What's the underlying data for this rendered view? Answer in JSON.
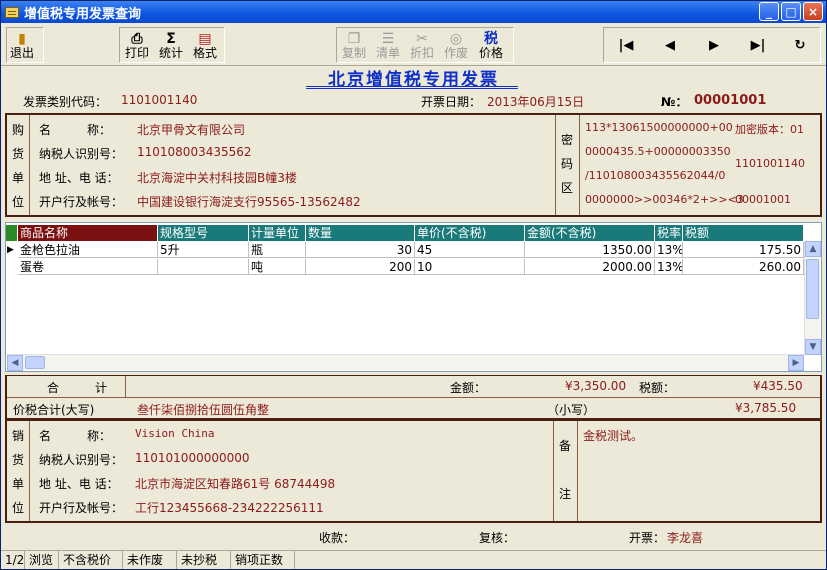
{
  "window": {
    "title": "增值税专用发票查询",
    "min": "_",
    "max": "□",
    "close": "×"
  },
  "toolbar": {
    "exit": "退出",
    "print": "打印",
    "stats": "统计",
    "format": "格式",
    "copy": "复制",
    "list": "清单",
    "discount": "折扣",
    "void": "作废",
    "tax_price_top": "税",
    "tax_price": "价格",
    "nav_first": "|◀",
    "nav_prev": "◀",
    "nav_next": "▶",
    "nav_last": "▶|",
    "nav_refresh": "↻"
  },
  "form": {
    "title": "北京增值税专用发票",
    "code_label": "发票类别代码：",
    "code": "1101001140",
    "date_label": "开票日期：",
    "date": "2013年06月15日",
    "no_label": "№：",
    "no": "00001001"
  },
  "buyer": {
    "side": [
      "购",
      "货",
      "单",
      "位"
    ],
    "name_label": "名　　　称：",
    "name": "北京甲骨文有限公司",
    "taxid_label": "纳税人识别号：",
    "taxid": "110108003435562",
    "addr_label": "地 址、电 话：",
    "addr": "北京海淀中关村科技园B幢3楼",
    "bank_label": "开户行及帐号：",
    "bank": "中国建设银行海淀支行95565-13562482"
  },
  "cipher": {
    "side": [
      "密",
      "码",
      "区"
    ],
    "lines": [
      "113*13061500000000+00",
      "0000435.5+00000003350",
      "/11010800343556204​4/0",
      "0000000>>00346*2+>><3"
    ],
    "version": "加密版本：01",
    "code": "1101001140",
    "number": "00001001"
  },
  "grid": {
    "headers": [
      "商品名称",
      "规格型号",
      "计量单位",
      "数量",
      "单价(不含税)",
      "金额(不含税)",
      "税率",
      "税额"
    ],
    "rows": [
      [
        "金枪色拉油",
        "5升",
        "瓶",
        "30",
        "45",
        "1350.00",
        "13%",
        "175.50"
      ],
      [
        "蛋卷",
        "",
        "吨",
        "200",
        "10",
        "2000.00",
        "13%",
        "260.00"
      ]
    ],
    "current_marker": "▶"
  },
  "totals": {
    "label": "合　　　计",
    "amount_label": "金额：",
    "amount": "¥3,350.00",
    "tax_label": "税额：",
    "tax": "¥435.50",
    "sum_label": "价税合计(大写)",
    "sum_words": "叁仟柒佰捌拾伍圆伍角整",
    "small_label": "（小写）",
    "sum_small": "¥3,785.50"
  },
  "seller": {
    "side": [
      "销",
      "货",
      "单",
      "位"
    ],
    "name_label": "名　　　称：",
    "name": "Vision China",
    "taxid_label": "纳税人识别号：",
    "taxid": "110101000000000",
    "addr_label": "地 址、电 话：",
    "addr": "北京市海淀区知春路61号 68744498",
    "bank_label": "开户行及帐号：",
    "bank": "工行123455668-234222256111"
  },
  "remarks": {
    "side": [
      "备",
      "注"
    ],
    "text": "金税测试。"
  },
  "footer": {
    "payee_label": "收款：",
    "payee": "",
    "reviewer_label": "复核：",
    "reviewer": "",
    "drawer_label": "开票：",
    "drawer": "李龙喜"
  },
  "statusbar": [
    "1/2",
    "浏览",
    "不含税价",
    "未作废",
    "未抄税",
    "销项正数"
  ]
}
